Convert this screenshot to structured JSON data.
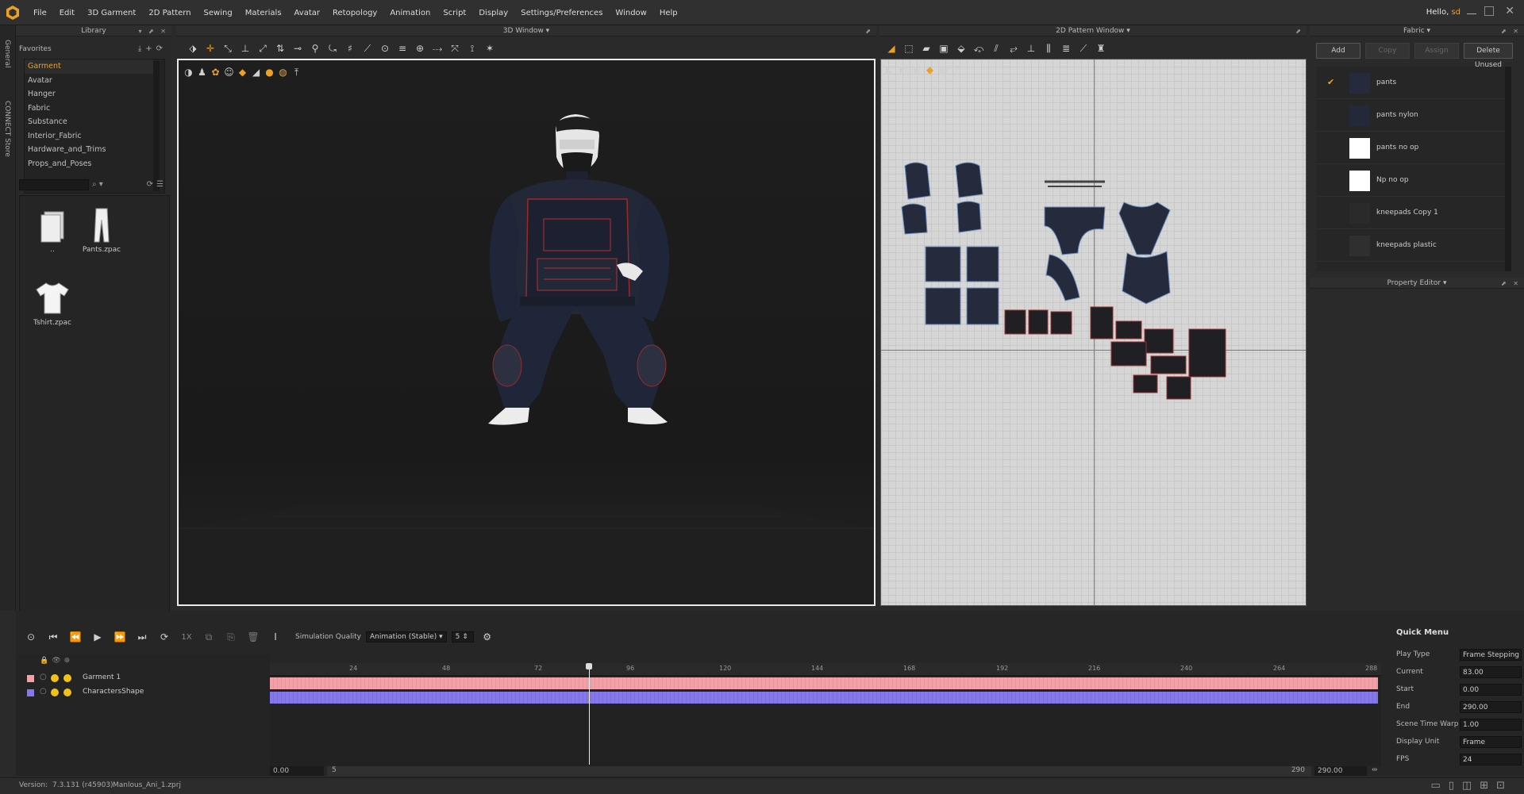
{
  "menubar": {
    "items": [
      "File",
      "Edit",
      "3D Garment",
      "2D Pattern",
      "Sewing",
      "Materials",
      "Avatar",
      "Retopology",
      "Animation",
      "Script",
      "Display",
      "Settings/Preferences",
      "Window",
      "Help"
    ],
    "greeting": "Hello,",
    "user": "sd"
  },
  "side_strip": {
    "general": "General",
    "store": "CONNECT Store"
  },
  "library": {
    "title": "Library",
    "favorites": "Favorites",
    "tree": [
      "Garment",
      "Avatar",
      "Hanger",
      "Fabric",
      "Substance",
      "Interior_Fabric",
      "Hardware_and_Trims",
      "Props_and_Poses"
    ],
    "files": [
      {
        "name": "..",
        "icon": "folder-icon"
      },
      {
        "name": "Pants.zpac",
        "icon": "pants-icon"
      },
      {
        "name": "Tshirt.zpac",
        "icon": "tshirt-icon"
      }
    ]
  },
  "view3d": {
    "title": "3D Window"
  },
  "view2d": {
    "title": "2D Pattern Window"
  },
  "fabric": {
    "title": "Fabric",
    "buttons": {
      "add": "Add",
      "copy": "Copy",
      "assign": "Assign",
      "delete_unused": "Delete Unused"
    },
    "items": [
      {
        "name": "pants",
        "color": "#252b3d",
        "checked": true
      },
      {
        "name": "pants nylon",
        "color": "#232939",
        "checked": false
      },
      {
        "name": "pants no op",
        "color": "#ffffff",
        "checked": false
      },
      {
        "name": "Np no op",
        "color": "#ffffff",
        "checked": false
      },
      {
        "name": "kneepads Copy 1",
        "color": "#2a2a2a",
        "checked": false
      },
      {
        "name": "kneepads plastic",
        "color": "#2f2f2f",
        "checked": false
      }
    ]
  },
  "property_editor": {
    "title": "Property Editor"
  },
  "animation": {
    "speed": "1X",
    "sim_quality_label": "Simulation Quality",
    "sim_quality_value": "Animation (Stable)",
    "sim_steps": "5",
    "ruler_ticks": [
      "24",
      "48",
      "72",
      "96",
      "120",
      "144",
      "168",
      "192",
      "216",
      "240",
      "264",
      "288"
    ],
    "ruler_max": 288,
    "playhead_frame": 83,
    "tracks": [
      {
        "name": "Garment 1",
        "color": "#f3a0a8"
      },
      {
        "name": "CharactersShape",
        "color": "#8578e8"
      }
    ],
    "range_start": "0.00",
    "scroll_start": "5",
    "scroll_end": "290",
    "range_end": "290.00"
  },
  "quick_menu": {
    "title": "Quick Menu",
    "rows": [
      {
        "label": "Play Type",
        "value": "Frame Stepping"
      },
      {
        "label": "Current",
        "value": "83.00"
      },
      {
        "label": "Start",
        "value": "0.00"
      },
      {
        "label": "End",
        "value": "290.00"
      },
      {
        "label": "Scene Time Warp",
        "value": "1.00"
      },
      {
        "label": "Display Unit",
        "value": "Frame"
      },
      {
        "label": "FPS",
        "value": "24"
      }
    ]
  },
  "status": {
    "version_label": "Version:",
    "version": "7.3.131 (r45903)",
    "file": "Manlous_Ani_1.zprj"
  }
}
